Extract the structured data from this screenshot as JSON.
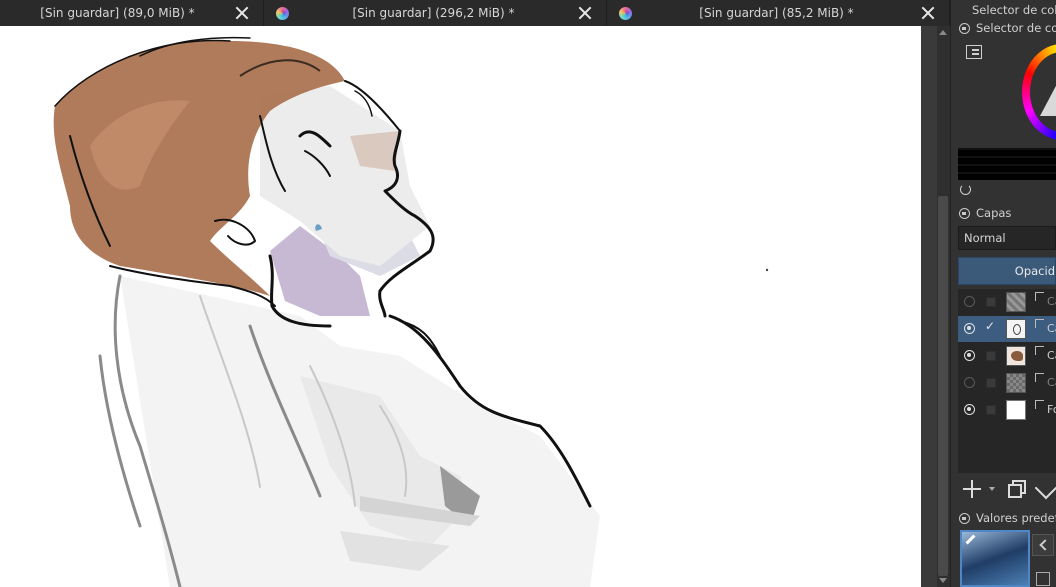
{
  "tabs": [
    {
      "title": "[Sin guardar]  (89,0 MiB) *"
    },
    {
      "title": "[Sin guardar]  (296,2 MiB) *"
    },
    {
      "title": "[Sin guardar]  (85,2 MiB) *"
    }
  ],
  "docker": {
    "top_title": "Selector de colo",
    "color_selector_title": "Selector de col",
    "layers_title": "Capas",
    "blend_mode": "Normal",
    "opacity_label": "Opacid",
    "layers": [
      {
        "label": "Ca",
        "visible": false,
        "checked": false
      },
      {
        "label": "Ca",
        "visible": true,
        "checked": true
      },
      {
        "label": "Ca",
        "visible": true,
        "checked": false
      },
      {
        "label": "Ca",
        "visible": false,
        "checked": false
      },
      {
        "label": "Fo",
        "visible": true,
        "checked": false
      }
    ],
    "presets_title": "Valores predef"
  },
  "colors": {
    "accent": "#3d5d80",
    "hair": "#a8704d",
    "shadow": "#b9a6c9"
  },
  "icons": [
    "krita-icon",
    "close-icon",
    "lock-icon",
    "list-view-icon",
    "refresh-icon",
    "eye-icon",
    "add-layer-icon",
    "duplicate-layer-icon",
    "chevron-down-icon",
    "pencil-icon"
  ]
}
